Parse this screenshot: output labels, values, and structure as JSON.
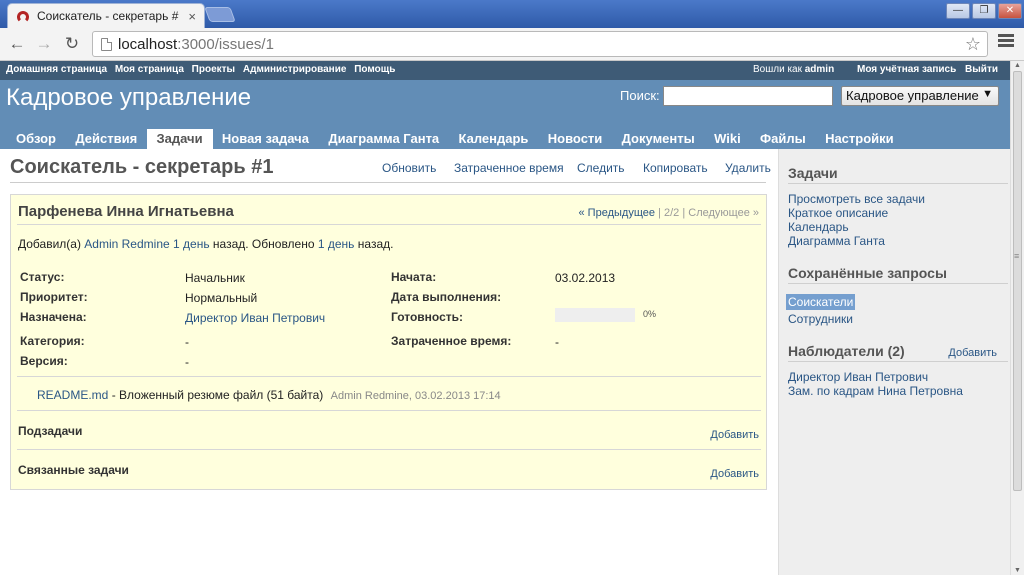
{
  "browser": {
    "tab_title": "Соискатель - секретарь #",
    "tab_close": "×",
    "url_host": "localhost",
    "url_rest": ":3000/issues/1",
    "back": "←",
    "forward": "→",
    "reload": "↻",
    "star": "☆",
    "win_min": "—",
    "win_max": "❐",
    "win_close": "✕"
  },
  "top_menu": {
    "items": [
      "Домашняя страница",
      "Моя страница",
      "Проекты",
      "Администрирование",
      "Помощь"
    ],
    "logged_prefix": "Вошли как",
    "logged_user": "admin",
    "my_account": "Моя учётная запись",
    "logout": "Выйти"
  },
  "header": {
    "title": "Кадровое управление",
    "search_label": "Поиск:",
    "search_value": "",
    "project_select": "Кадровое управление",
    "select_arrow": "▼"
  },
  "main_menu": {
    "items": [
      "Обзор",
      "Действия",
      "Задачи",
      "Новая задача",
      "Диаграмма Ганта",
      "Календарь",
      "Новости",
      "Документы",
      "Wiki",
      "Файлы",
      "Настройки"
    ],
    "selected": "Задачи"
  },
  "issue": {
    "heading": "Соискатель - секретарь #1",
    "actions": {
      "update": "Обновить",
      "spent_time": "Затраченное время",
      "watch": "Следить",
      "copy": "Копировать",
      "delete": "Удалить"
    },
    "subject": "Парфенева Инна Игнатьевна",
    "nav": {
      "prev": "« Предыдущее",
      "sep1": "|",
      "position": "2/2",
      "sep2": "|",
      "next": "Следующее »"
    },
    "author": {
      "added_prefix": "Добавил(а)",
      "author_name": "Admin Redmine",
      "added_ago": "1 день",
      "added_suffix": "назад. Обновлено",
      "updated_ago": "1 день",
      "updated_suffix": "назад."
    },
    "attributes": {
      "status_label": "Статус:",
      "status_value": "Начальник",
      "priority_label": "Приоритет:",
      "priority_value": "Нормальный",
      "assigned_label": "Назначена:",
      "assigned_value": "Директор Иван Петрович",
      "category_label": "Категория:",
      "category_value": "-",
      "version_label": "Версия:",
      "version_value": "-",
      "start_label": "Начата:",
      "start_value": "03.02.2013",
      "due_label": "Дата выполнения:",
      "due_value": "",
      "done_label": "Готовность:",
      "done_ratio": 0,
      "done_text": "0%",
      "spent_label": "Затраченное время:",
      "spent_value": "-"
    },
    "attachment": {
      "filename": "README.md",
      "description": "- Вложенный резюме файл (51 байта)",
      "meta": "Admin Redmine, 03.02.2013 17:14"
    },
    "subtasks": {
      "title": "Подзадачи",
      "add": "Добавить"
    },
    "relations": {
      "title": "Связанные задачи",
      "add": "Добавить"
    }
  },
  "sidebar": {
    "issues_title": "Задачи",
    "issues_links": [
      "Просмотреть все задачи",
      "Краткое описание",
      "Календарь",
      "Диаграмма Ганта"
    ],
    "queries_title": "Сохранённые запросы",
    "queries": [
      "Соискатели",
      "Сотрудники"
    ],
    "watchers_title": "Наблюдатели (2)",
    "watchers_add": "Добавить",
    "watchers": [
      "Директор Иван Петрович",
      "Зам. по кадрам Нина Петровна"
    ]
  },
  "colors": {
    "top_menu_bg": "#3e5b76",
    "header_bg": "#628db6",
    "issue_bg": "#ffffdd",
    "sidebar_bg": "#eeeeee",
    "link": "#2a5685",
    "selected_query_bg": "#759fcf"
  }
}
